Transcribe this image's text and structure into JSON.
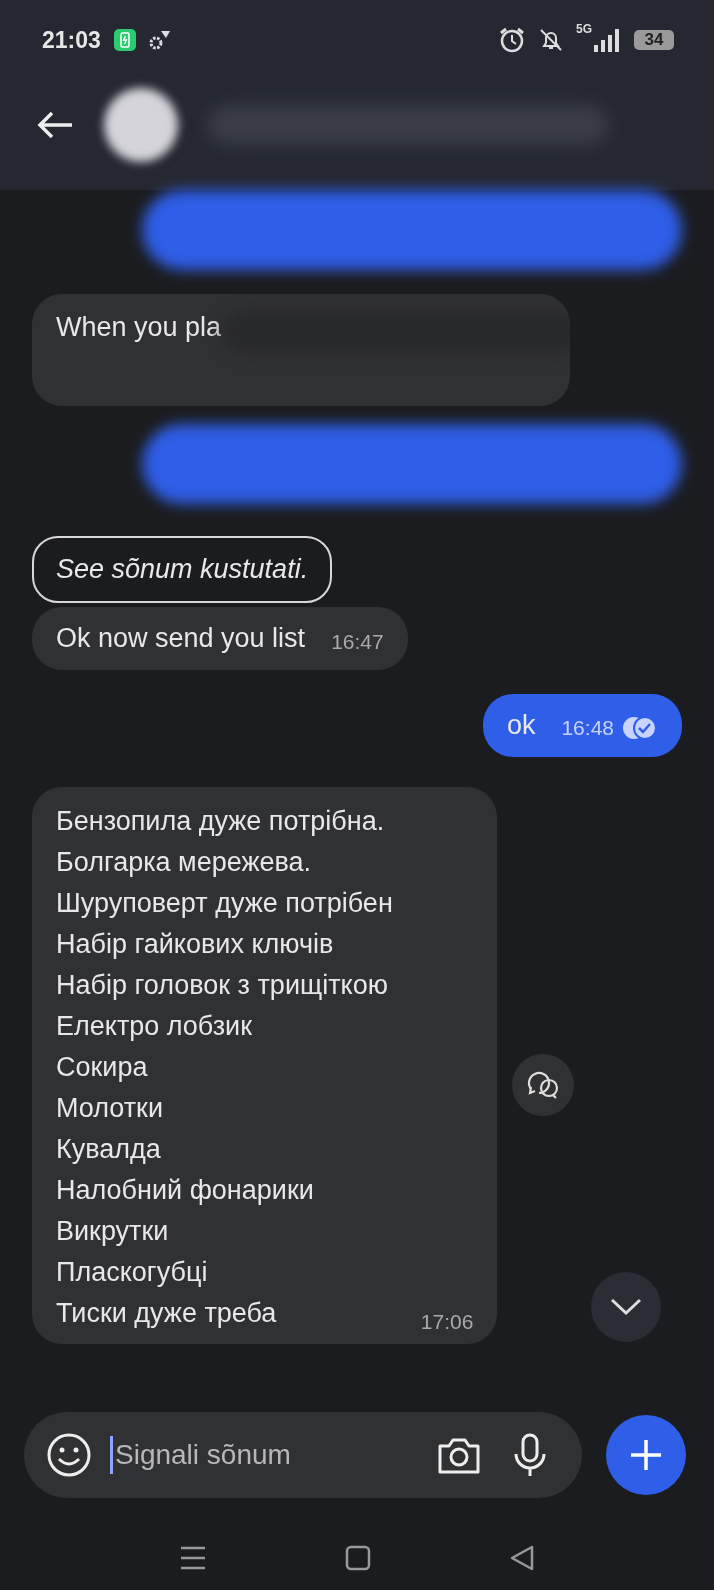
{
  "status_bar": {
    "time": "21:03",
    "battery": "34",
    "network": "5G"
  },
  "messages": [
    {
      "kind": "blurred",
      "outgoing": true
    },
    {
      "kind": "partial",
      "outgoing": false,
      "text": "When you pla"
    },
    {
      "kind": "blurred",
      "outgoing": true
    },
    {
      "kind": "deleted",
      "outgoing": false,
      "text": "See sõnum kustutati."
    },
    {
      "kind": "text",
      "outgoing": false,
      "text": "Ok now send you list",
      "time": "16:47"
    },
    {
      "kind": "text",
      "outgoing": true,
      "text": "ok",
      "time": "16:48",
      "read": true
    },
    {
      "kind": "list",
      "outgoing": false,
      "time": "17:06",
      "lines": [
        "Бензопила дуже потрібна.",
        "Болгарка мережева.",
        "Шуруповерт дуже потрібен",
        "Набір гайкових ключів",
        "Набір головок з трищіткою",
        "Електро лобзик",
        "Сокира",
        "Молотки",
        "Кувалда",
        "Налобний фонарики",
        "Викрутки",
        "Пласкогубці",
        "Тиски дуже треба"
      ]
    }
  ],
  "composer": {
    "placeholder": "Signali sõnum"
  }
}
